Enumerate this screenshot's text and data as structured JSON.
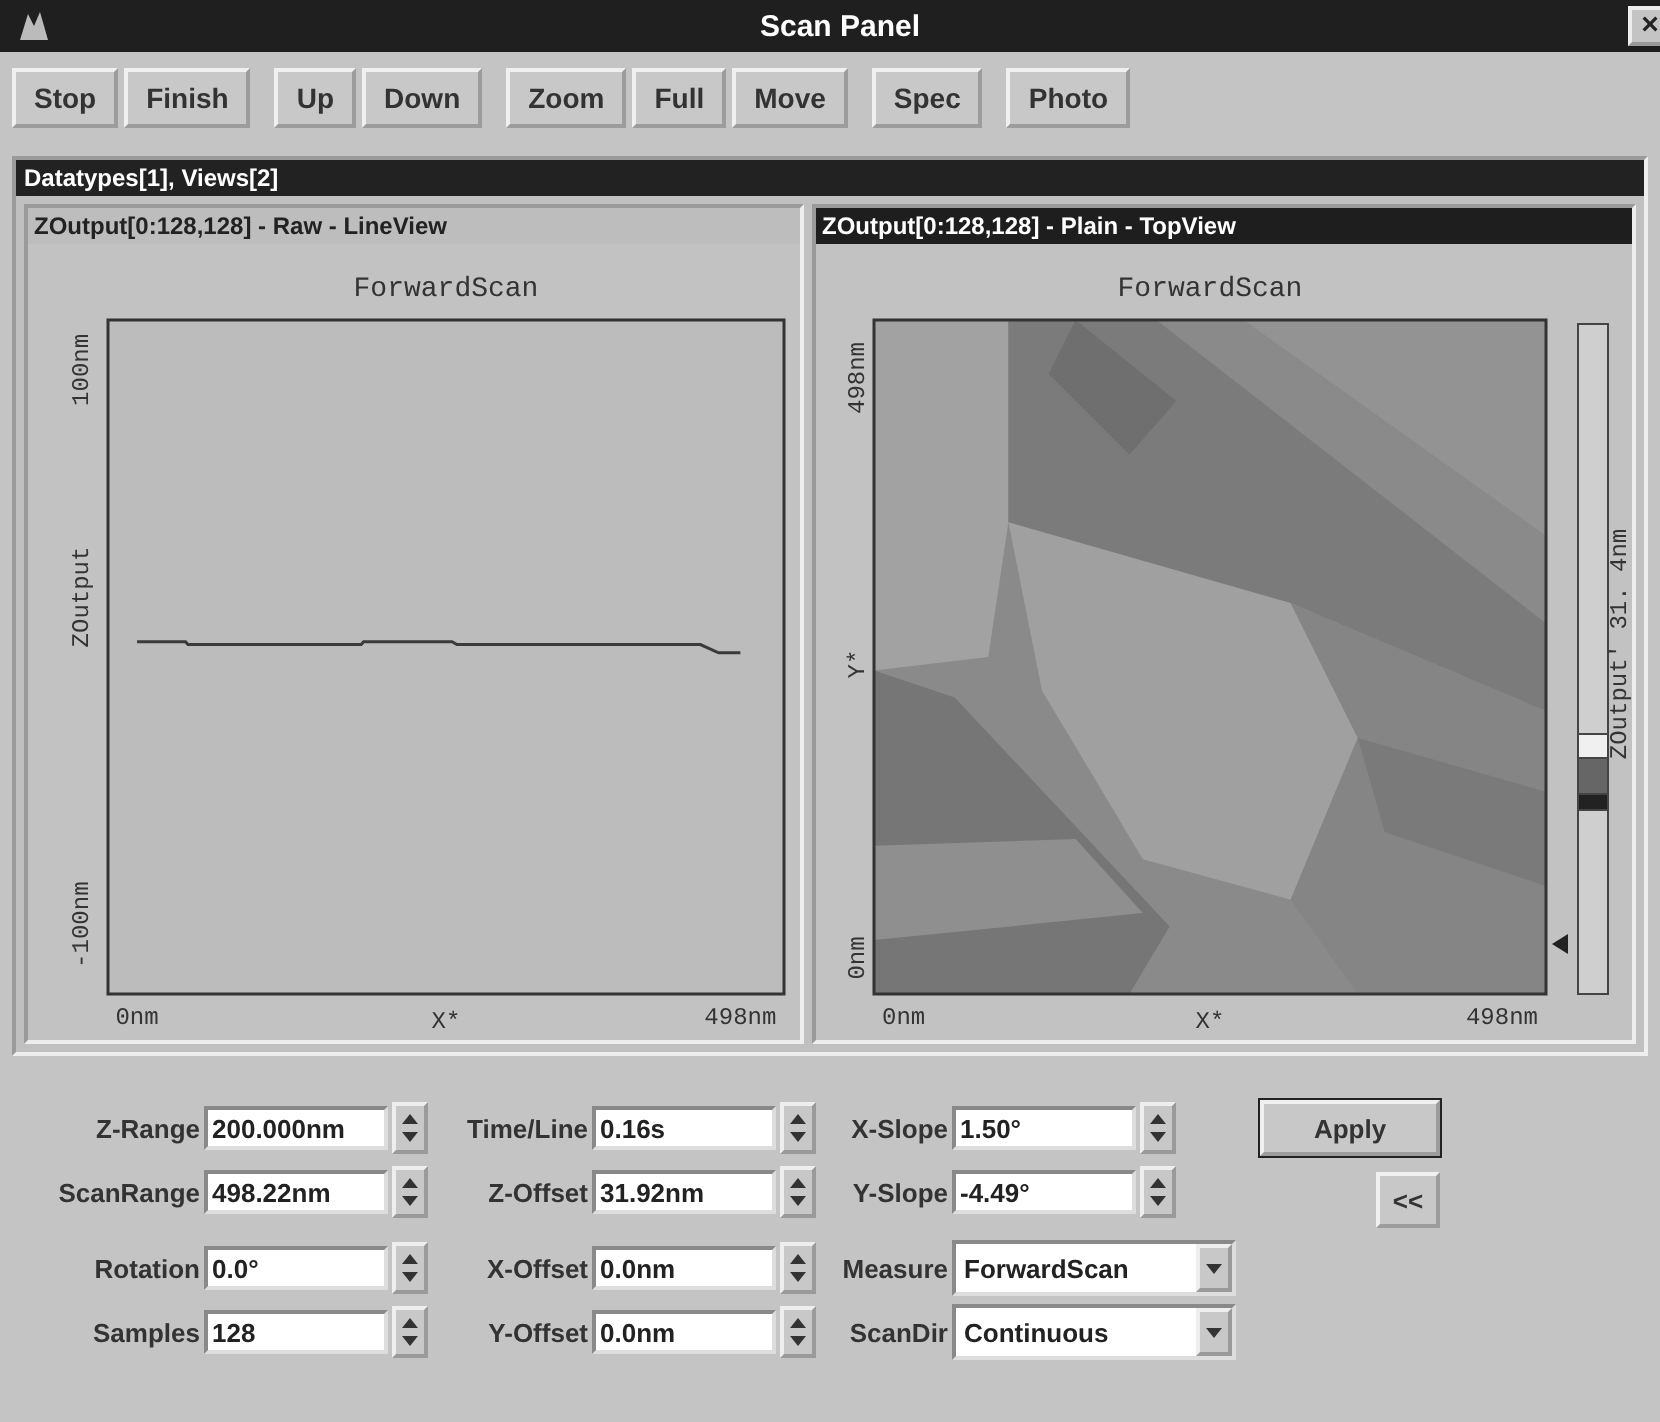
{
  "window": {
    "title": "Scan Panel",
    "close": "×"
  },
  "toolbar": [
    {
      "buttons": [
        "Stop",
        "Finish"
      ]
    },
    {
      "buttons": [
        "Up",
        "Down"
      ]
    },
    {
      "buttons": [
        "Zoom",
        "Full",
        "Move"
      ]
    },
    {
      "buttons": [
        "Spec"
      ]
    },
    {
      "buttons": [
        "Photo"
      ]
    }
  ],
  "document": {
    "title": "Datatypes[1], Views[2]",
    "views": [
      {
        "title": "ZOutput[0:128,128] - Raw - LineView",
        "active": false,
        "kind": "line",
        "chart_data": {
          "type": "line",
          "title": "ForwardScan",
          "xlabel": "X*",
          "ylabel": "ZOutput",
          "x": [
            0,
            40,
            42,
            185,
            187,
            260,
            264,
            465,
            480,
            498
          ],
          "series": [
            {
              "color": "#3a3a3a",
              "values": [
                2,
                2,
                1,
                1,
                2,
                2,
                1,
                1,
                -2,
                -2
              ]
            }
          ],
          "xlim": [
            -24,
            534
          ],
          "ylim": [
            -125,
            118
          ],
          "xticks": [
            {
              "value": 0,
              "label": "0nm"
            },
            {
              "value": 498,
              "label": "498nm"
            }
          ],
          "yticks": [
            {
              "value": 100,
              "label": "100nm"
            },
            {
              "value": -100,
              "label": "-100nm"
            }
          ]
        }
      },
      {
        "title": "ZOutput[0:128,128] - Plain - TopView",
        "active": true,
        "plot_title": "ForwardScan",
        "y_top": "498nm",
        "y_label": "Y*",
        "y_bottom": "0nm",
        "x_left": "0nm",
        "x_label": "X*",
        "x_right": "498nm",
        "scale_label": "ZOutput' 31. 4nm"
      }
    ]
  },
  "settings": {
    "columns": [
      [
        {
          "label": "Z-Range",
          "value": "200.000nm",
          "kind": "spin"
        },
        {
          "label": "ScanRange",
          "value": "498.22nm",
          "kind": "spin"
        },
        {
          "label": "Rotation",
          "value": "0.0°",
          "kind": "spin"
        },
        {
          "label": "Samples",
          "value": "128",
          "kind": "spin"
        }
      ],
      [
        {
          "label": "Time/Line",
          "value": "0.16s",
          "kind": "spin"
        },
        {
          "label": "Z-Offset",
          "value": "31.92nm",
          "kind": "spin"
        },
        {
          "label": "X-Offset",
          "value": "0.0nm",
          "kind": "spin"
        },
        {
          "label": "Y-Offset",
          "value": "0.0nm",
          "kind": "spin"
        }
      ],
      [
        {
          "label": "X-Slope",
          "value": "1.50°",
          "kind": "spin"
        },
        {
          "label": "Y-Slope",
          "value": "-4.49°",
          "kind": "spin"
        },
        {
          "label": "Measure",
          "value": "ForwardScan",
          "kind": "dropdown"
        },
        {
          "label": "ScanDir",
          "value": "Continuous",
          "kind": "dropdown"
        }
      ]
    ],
    "buttons": [
      "Apply",
      "<<"
    ]
  }
}
